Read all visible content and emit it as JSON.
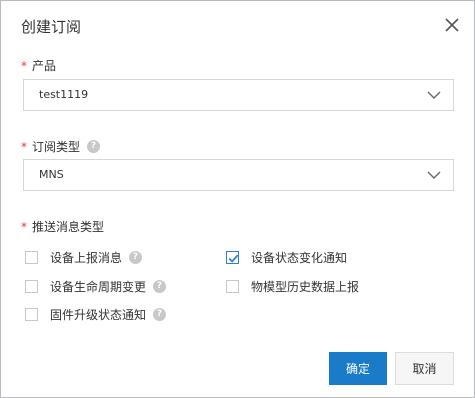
{
  "dialog": {
    "title": "创建订阅",
    "close_icon": "close-icon"
  },
  "product": {
    "required_mark": "*",
    "label": "产品",
    "value": "test1119"
  },
  "subscription_type": {
    "required_mark": "*",
    "label": "订阅类型",
    "help_icon": "question-circle-icon",
    "value": "MNS"
  },
  "message_types": {
    "required_mark": "*",
    "label": "推送消息类型",
    "options": [
      {
        "label": "设备上报消息",
        "checked": false,
        "help": true
      },
      {
        "label": "设备状态变化通知",
        "checked": true,
        "help": false
      },
      {
        "label": "设备生命周期变更",
        "checked": false,
        "help": true
      },
      {
        "label": "物模型历史数据上报",
        "checked": false,
        "help": false
      },
      {
        "label": "固件升级状态通知",
        "checked": false,
        "help": true
      }
    ]
  },
  "footer": {
    "confirm_label": "确定",
    "cancel_label": "取消"
  },
  "colors": {
    "primary": "#1a7bc9",
    "required": "#e4393c",
    "checkbox_checked": "#2f7fd3"
  }
}
